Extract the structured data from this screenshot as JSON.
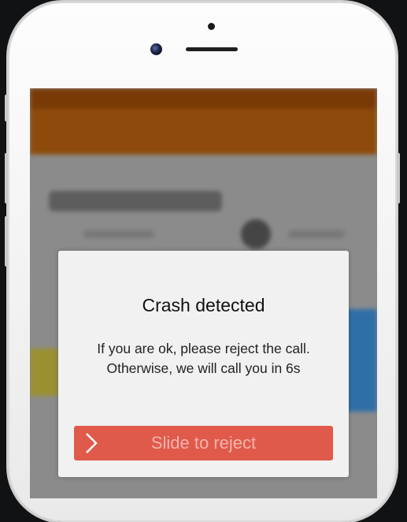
{
  "dialog": {
    "title": "Crash detected",
    "message_line1": "If you are ok, please reject the call.",
    "message_line2": "Otherwise, we will call you in 6s",
    "slider_label": "Slide to reject"
  },
  "colors": {
    "slider_bg": "#e05a4c",
    "slider_text": "#f2b3ab",
    "dialog_bg": "#f1f1f1",
    "app_header": "#8d4a0a"
  },
  "icons": {
    "slider_handle": "chevron-right-icon"
  }
}
